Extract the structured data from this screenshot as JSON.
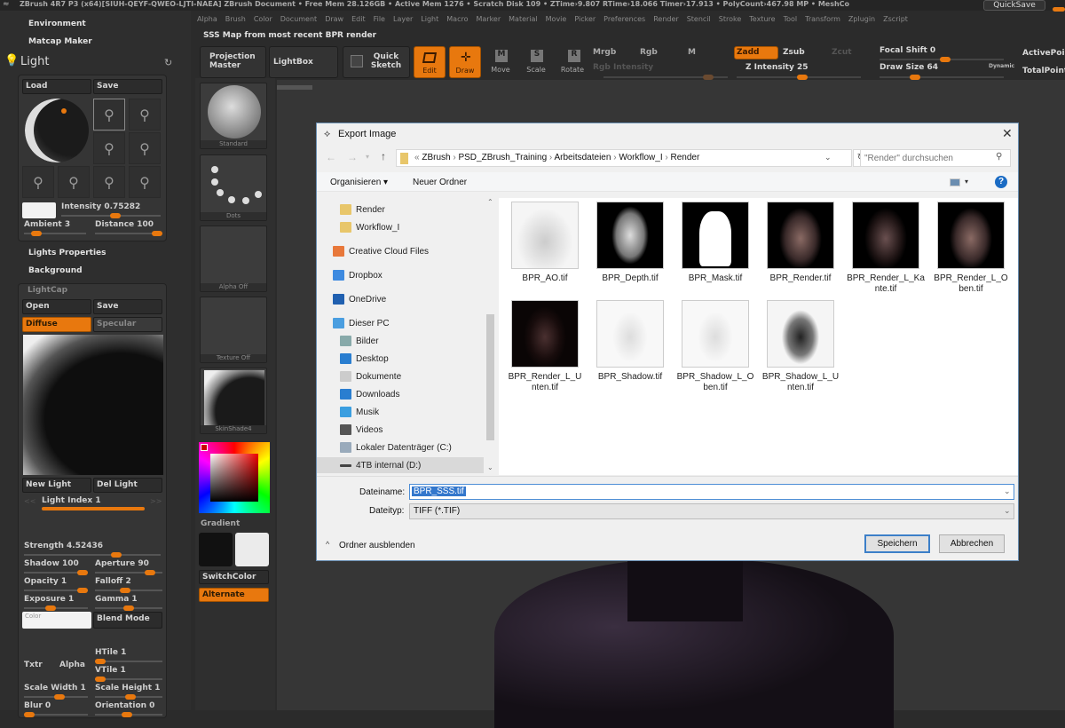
{
  "app": {
    "title_bar": "ZBrush 4R7 P3 (x64)[SIUH-QEYF-QWEO-LJTI-NAEA]    ZBrush Document      • Free Mem 28.126GB • Active Mem 1276 • Scratch Disk 109 • ZTime›9.807 RTime›18.066 Timer›17.913 • PolyCount›467.98 MP • MeshCo",
    "quicksave": "QuickSave"
  },
  "menu": [
    "Alpha",
    "Brush",
    "Color",
    "Document",
    "Draw",
    "Edit",
    "File",
    "Layer",
    "Light",
    "Macro",
    "Marker",
    "Material",
    "Movie",
    "Picker",
    "Preferences",
    "Render",
    "Stencil",
    "Stroke",
    "Texture",
    "Tool",
    "Transform",
    "Zplugin",
    "Zscript"
  ],
  "info_text": "SSS Map from most recent BPR render",
  "left": {
    "environment": "Environment",
    "matcap_maker": "Matcap Maker",
    "light_title": "Light",
    "load": "Load",
    "save": "Save",
    "intensity": "Intensity 0.75282",
    "intensity_value": 0.75282,
    "ambient": "Ambient 3",
    "distance": "Distance 100",
    "lights_properties": "Lights Properties",
    "background": "Background",
    "lightcap": "LightCap",
    "open": "Open",
    "save2": "Save",
    "diffuse": "Diffuse",
    "specular": "Specular",
    "new_light": "New Light",
    "del_light": "Del Light",
    "light_index": "Light Index 1",
    "prev": "<<",
    "next": ">>",
    "strength": "Strength 4.52436",
    "shadow": "Shadow 100",
    "aperture": "Aperture 90",
    "opacity": "Opacity 1",
    "falloff": "Falloff 2",
    "exposure": "Exposure 1",
    "gamma": "Gamma 1",
    "color": "Color",
    "blend_mode": "Blend Mode",
    "txtr": "Txtr",
    "alpha": "Alpha",
    "htile": "HTile 1",
    "vtile": "VTile 1",
    "scale_width": "Scale Width 1",
    "scale_height": "Scale Height 1",
    "blur": "Blur 0",
    "orientation": "Orientation 0"
  },
  "toolbar": {
    "projection_master": "Projection Master",
    "lightbox": "LightBox",
    "quick_sketch": "Quick Sketch",
    "edit": "Edit",
    "draw": "Draw",
    "move": "Move",
    "scale": "Scale",
    "rotate": "Rotate",
    "mrgb": "Mrgb",
    "rgb": "Rgb",
    "m": "M",
    "rgb_intensity": "Rgb Intensity",
    "zadd": "Zadd",
    "zsub": "Zsub",
    "zcut": "Zcut",
    "z_intensity": "Z Intensity 25",
    "focal_shift": "Focal Shift 0",
    "draw_size": "Draw Size 64",
    "dynamic": "Dynamic",
    "active_points": "ActivePoints",
    "total_points": "TotalPoints"
  },
  "shelf": {
    "brush": "Standard",
    "stroke": "Dots",
    "alpha": "Alpha Off",
    "texture": "Texture Off",
    "material": "SkinShade4",
    "gradient": "Gradient",
    "switch_color": "SwitchColor",
    "alternate": "Alternate"
  },
  "dialog": {
    "title": "Export Image",
    "breadcrumb": [
      "«",
      "ZBrush",
      "PSD_ZBrush_Training",
      "Arbeitsdateien",
      "Workflow_I",
      "Render"
    ],
    "search_placeholder": "\"Render\" durchsuchen",
    "organize": "Organisieren ▾",
    "new_folder": "Neuer Ordner",
    "nav": [
      {
        "label": "Render",
        "icon": "folder-icon"
      },
      {
        "label": "Workflow_I",
        "icon": "folder-icon"
      },
      {
        "label": "Creative Cloud Files",
        "icon": "creative-cloud-icon"
      },
      {
        "label": "Dropbox",
        "icon": "dropbox-icon"
      },
      {
        "label": "OneDrive",
        "icon": "onedrive-icon"
      },
      {
        "label": "Dieser PC",
        "icon": "computer-icon"
      },
      {
        "label": "Bilder",
        "icon": "pictures-icon"
      },
      {
        "label": "Desktop",
        "icon": "desktop-icon"
      },
      {
        "label": "Dokumente",
        "icon": "documents-icon"
      },
      {
        "label": "Downloads",
        "icon": "downloads-icon"
      },
      {
        "label": "Musik",
        "icon": "music-icon"
      },
      {
        "label": "Videos",
        "icon": "videos-icon"
      },
      {
        "label": "Lokaler Datenträger (C:)",
        "icon": "drive-c-icon"
      },
      {
        "label": "4TB internal (D:)",
        "icon": "drive-d-icon"
      }
    ],
    "files": [
      {
        "name": "BPR_AO.tif",
        "kind": "ao"
      },
      {
        "name": "BPR_Depth.tif",
        "kind": "depth"
      },
      {
        "name": "BPR_Mask.tif",
        "kind": "mask"
      },
      {
        "name": "BPR_Render.tif",
        "kind": "render"
      },
      {
        "name": "BPR_Render_L_Kante.tif",
        "kind": "render-dark"
      },
      {
        "name": "BPR_Render_L_Oben.tif",
        "kind": "render"
      },
      {
        "name": "BPR_Render_L_Unten.tif",
        "kind": "render-darker"
      },
      {
        "name": "BPR_Shadow.tif",
        "kind": "shadow"
      },
      {
        "name": "BPR_Shadow_L_Oben.tif",
        "kind": "shadow"
      },
      {
        "name": "BPR_Shadow_L_Unten.tif",
        "kind": "shadow-dark"
      }
    ],
    "filename_label": "Dateiname:",
    "filename_value": "BPR_SSS.tif",
    "filetype_label": "Dateityp:",
    "filetype_value": "TIFF (*.TIF)",
    "hide_folders": "Ordner ausblenden",
    "save": "Speichern",
    "cancel": "Abbrechen"
  }
}
